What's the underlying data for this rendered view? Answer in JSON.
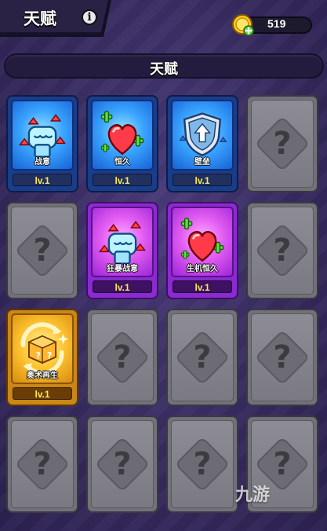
{
  "header": {
    "title": "天赋",
    "coins": "519",
    "coin_icon": "gold-coin-plus-icon",
    "info_icon": "info-icon"
  },
  "section": {
    "title": "天赋"
  },
  "cards": [
    {
      "name": "战意",
      "level": "lv.1",
      "rarity": "blue",
      "icon": "fist-arrows-icon"
    },
    {
      "name": "恒久",
      "level": "lv.1",
      "rarity": "blue",
      "icon": "heart-plus-icon"
    },
    {
      "name": "壁垒",
      "level": "lv.1",
      "rarity": "blue",
      "icon": "shield-arrow-icon"
    },
    {
      "name": "",
      "level": "",
      "rarity": "locked",
      "icon": "question-icon"
    },
    {
      "name": "",
      "level": "",
      "rarity": "locked",
      "icon": "question-icon"
    },
    {
      "name": "狂暴战意",
      "level": "lv.1",
      "rarity": "purple",
      "icon": "fist-arrows-icon"
    },
    {
      "name": "生机恒久",
      "level": "lv.1",
      "rarity": "purple",
      "icon": "heart-plus-icon"
    },
    {
      "name": "",
      "level": "",
      "rarity": "locked",
      "icon": "question-icon"
    },
    {
      "name": "奥术再生",
      "level": "lv.1",
      "rarity": "gold",
      "icon": "dice-cycle-icon"
    },
    {
      "name": "",
      "level": "",
      "rarity": "locked",
      "icon": "question-icon"
    },
    {
      "name": "",
      "level": "",
      "rarity": "locked",
      "icon": "question-icon"
    },
    {
      "name": "",
      "level": "",
      "rarity": "locked",
      "icon": "question-icon"
    },
    {
      "name": "",
      "level": "",
      "rarity": "locked",
      "icon": "question-icon"
    },
    {
      "name": "",
      "level": "",
      "rarity": "locked",
      "icon": "question-icon"
    },
    {
      "name": "",
      "level": "",
      "rarity": "locked",
      "icon": "question-icon"
    },
    {
      "name": "",
      "level": "",
      "rarity": "locked",
      "icon": "question-icon"
    }
  ],
  "locked_symbol": "?",
  "watermark": "九游",
  "colors": {
    "background": "#3b2f63",
    "blue_card": "#1a3d8a",
    "purple_card": "#8a2ad0",
    "gold_card": "#c98716",
    "locked_card": "#72717a",
    "level_text": "#ffe94a"
  }
}
